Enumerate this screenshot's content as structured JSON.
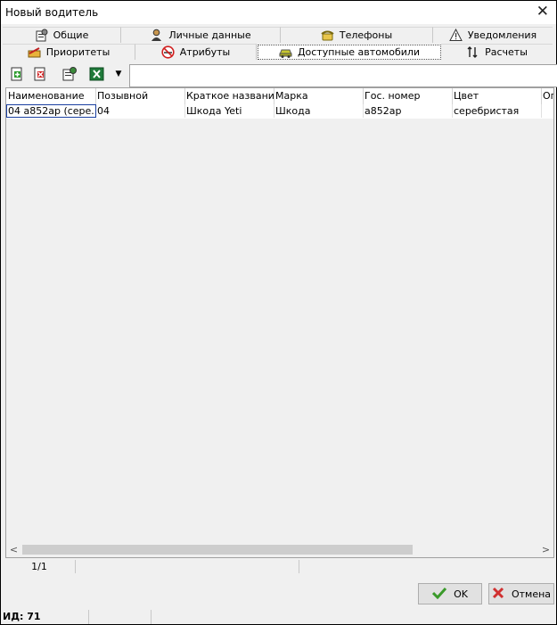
{
  "window": {
    "title": "Новый водитель"
  },
  "tabs_row1": [
    {
      "label": "Общие",
      "icon": "settings-doc-icon"
    },
    {
      "label": "Личные данные",
      "icon": "person-icon"
    },
    {
      "label": "Телефоны",
      "icon": "phone-icon"
    },
    {
      "label": "Уведомления",
      "icon": "warning-icon"
    }
  ],
  "tabs_row2": [
    {
      "label": "Приоритеты",
      "icon": "priority-icon"
    },
    {
      "label": "Атрибуты",
      "icon": "no-smoking-icon"
    },
    {
      "label": "Доступные автомобили",
      "icon": "car-icon",
      "active": true
    },
    {
      "label": "Расчеты",
      "icon": "sort-arrows-icon"
    }
  ],
  "toolbar": {
    "add": "add-icon",
    "delete": "delete-icon",
    "properties": "properties-icon",
    "excel": "excel-icon",
    "dropdown": "▼",
    "search_value": ""
  },
  "table": {
    "columns": [
      "Наименование",
      "Позывной",
      "Краткое название",
      "Марка",
      "Гос. номер",
      "Цвет",
      "Ог"
    ],
    "rows": [
      [
        "04 a852ар (сере...",
        "04",
        "Шкода Yeti",
        "Шкода",
        "а852ар",
        "серебристая",
        ""
      ]
    ]
  },
  "status": {
    "page": "1/1"
  },
  "buttons": {
    "ok": "OK",
    "cancel": "Отмена"
  },
  "footer": {
    "id_label": "ИД: 71"
  },
  "colors": {
    "accent": "#1a3fa0",
    "ok_green": "#3a9a2a",
    "cancel_red": "#d03030"
  }
}
